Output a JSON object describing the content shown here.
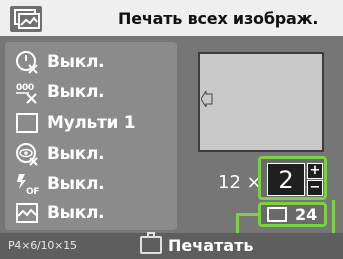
{
  "header": {
    "title": "Печать всех изображ.",
    "icon": "all-images-icon"
  },
  "menu": {
    "items": [
      {
        "icon": "date-off-icon",
        "label": "Выкл."
      },
      {
        "icon": "file-number-off-icon",
        "label": "Выкл."
      },
      {
        "icon": "multi-layout-icon",
        "label": "Мульти 1"
      },
      {
        "icon": "red-eye-correction-icon",
        "label": "Выкл."
      },
      {
        "icon": "flash-correction-off-icon",
        "label": "Выкл."
      },
      {
        "icon": "image-optimize-icon",
        "label": "Выкл."
      }
    ]
  },
  "preview": {
    "arrow_icon": "left-arrow-icon"
  },
  "quantity": {
    "multiplier_label": "12 ×",
    "copies": "2",
    "plus": "+",
    "minus": "−"
  },
  "sheets": {
    "icon": "sheet-icon",
    "count": "24"
  },
  "footer": {
    "paper_size": "P4×6/10×15",
    "print_icon": "print-icon",
    "print_label": "Печатать"
  },
  "colors": {
    "highlight": "#7bd043",
    "screen_bg": "#767676",
    "menu_bg": "#8b8b8b"
  }
}
